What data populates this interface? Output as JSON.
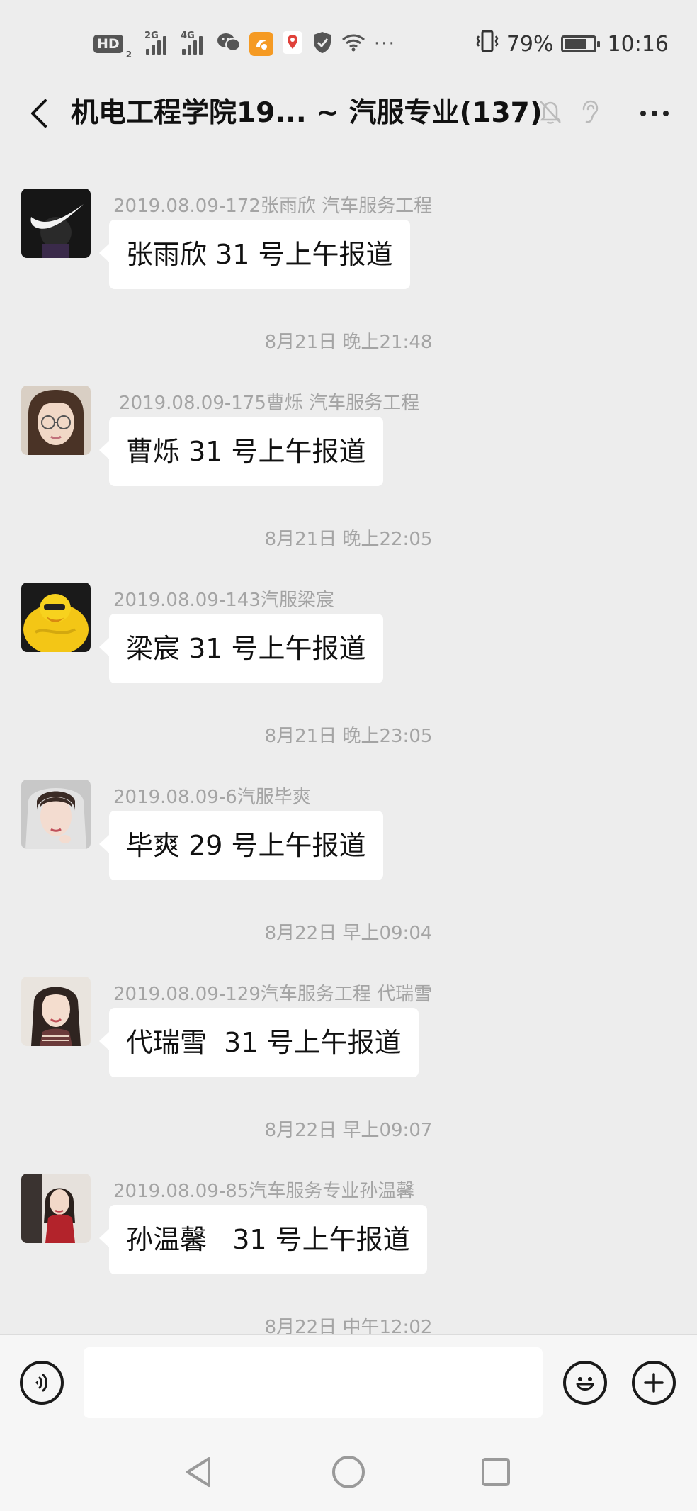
{
  "status_bar": {
    "hd_label": "HD",
    "hd_sub": "2",
    "net1": "2G",
    "net2": "4G",
    "battery_text": "79%",
    "battery_level": 0.79,
    "time": "10:16",
    "icons": [
      "wechat-icon",
      "uc-browser-icon",
      "location-pin-icon",
      "shield-icon",
      "wifi-icon",
      "more-dots",
      "vibrate-icon",
      "battery-icon"
    ]
  },
  "header": {
    "title": "机电工程学院19... ~ 汽服专业(137)",
    "icons": [
      "mute-icon",
      "earpiece-icon",
      "more-icon",
      "back-icon"
    ]
  },
  "messages": [
    {
      "sender": "2019.08.09-172张雨欣  汽车服务工程",
      "text": "张雨欣 31 号上午报道",
      "avatar": "avatar-nike"
    },
    {
      "time": "8月21日 晚上21:48"
    },
    {
      "sender": "2019.08.09-175曹烁 汽车服务工程",
      "text": "曹烁 31 号上午报道",
      "avatar": "avatar-glasses-girl"
    },
    {
      "time": "8月21日 晚上22:05"
    },
    {
      "sender": "2019.08.09-143汽服梁宸",
      "text": "梁宸 31 号上午报道",
      "avatar": "avatar-yellow-duck"
    },
    {
      "time": "8月21日 晚上23:05"
    },
    {
      "sender": "2019.08.09-6汽服毕爽",
      "text": "毕爽 29 号上午报道",
      "avatar": "avatar-veil-girl"
    },
    {
      "time": "8月22日 早上09:04"
    },
    {
      "sender": "2019.08.09-129汽车服务工程  代瑞雪",
      "text": "代瑞雪  31 号上午报道",
      "avatar": "avatar-long-hair-girl"
    },
    {
      "time": "8月22日 早上09:07"
    },
    {
      "sender": "2019.08.09-85汽车服务专业孙温馨",
      "text": "孙温馨   31 号上午报道",
      "avatar": "avatar-red-dress-girl"
    },
    {
      "time": "8月22日 中午12:02"
    }
  ],
  "input_bar": {
    "placeholder": "",
    "value": ""
  },
  "colors": {
    "background": "#ededed",
    "bubble": "#ffffff",
    "meta_text": "#a4a4a4"
  }
}
